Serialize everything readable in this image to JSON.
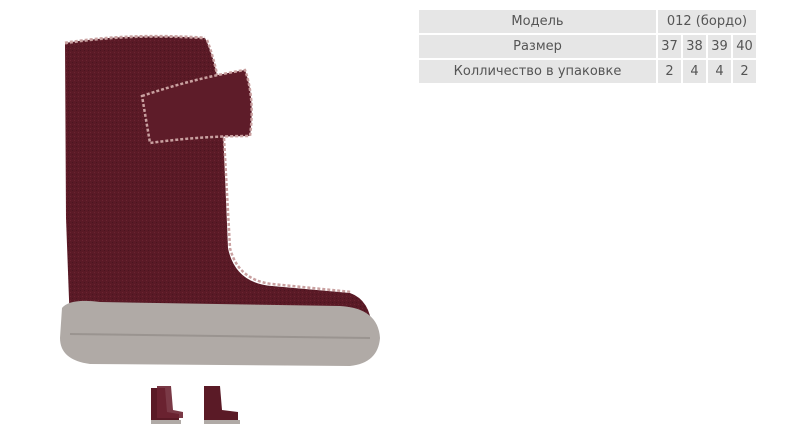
{
  "product": {
    "main_image_icon": "felt-boot-burgundy",
    "thumbnails": [
      {
        "icon": "boot-pair-thumbnail"
      },
      {
        "icon": "boot-side-thumbnail"
      }
    ],
    "colors": {
      "felt": "#5a1a26",
      "sole": "#b0aaa6",
      "stitch": "#c9a0a0"
    }
  },
  "specs": {
    "model_label": "Модель",
    "model_value": "012 (бордо)",
    "size_label": "Размер",
    "sizes": [
      "37",
      "38",
      "39",
      "40"
    ],
    "qty_label": "Колличество в упаковке",
    "quantities": [
      "2",
      "4",
      "4",
      "2"
    ]
  }
}
